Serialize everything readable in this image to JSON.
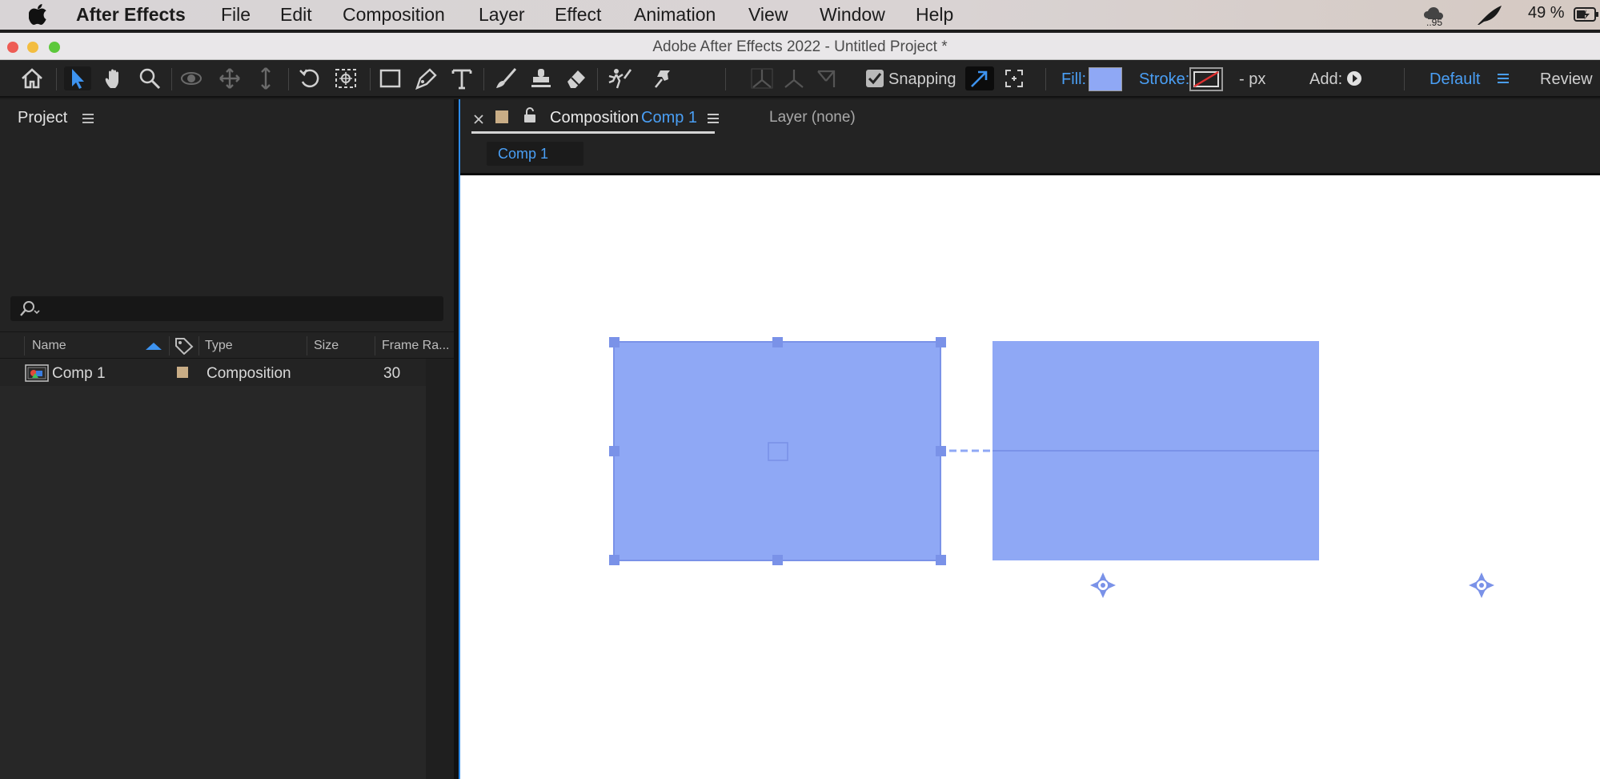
{
  "menubar": {
    "app_name": "After Effects",
    "items": [
      "File",
      "Edit",
      "Composition",
      "Layer",
      "Effect",
      "Animation",
      "View",
      "Window",
      "Help"
    ],
    "tray_badge": "..95",
    "battery": "49 %"
  },
  "window": {
    "title": "Adobe After Effects 2022 - Untitled Project *"
  },
  "toolbar": {
    "snapping_label": "Snapping",
    "snapping_checked": true,
    "fill_label": "Fill:",
    "fill_color": "#8fa8f5",
    "stroke_label": "Stroke:",
    "stroke_width": "- px",
    "add_label": "Add:",
    "workspace_label": "Default",
    "review_label": "Review",
    "accent_color": "#4a9ff5"
  },
  "project_panel": {
    "title": "Project",
    "columns": {
      "name": "Name",
      "type": "Type",
      "size": "Size",
      "frame_rate": "Frame Ra..."
    },
    "items": [
      {
        "name": "Comp 1",
        "type": "Composition",
        "frame_rate": "30",
        "label_color": "#c9ad86"
      }
    ]
  },
  "comp_panel": {
    "tab_prefix": "Composition",
    "tab_comp_name": "Comp 1",
    "layer_tab": "Layer (none)",
    "breadcrumb": "Comp 1",
    "shape_color": "#8fa8f5"
  }
}
